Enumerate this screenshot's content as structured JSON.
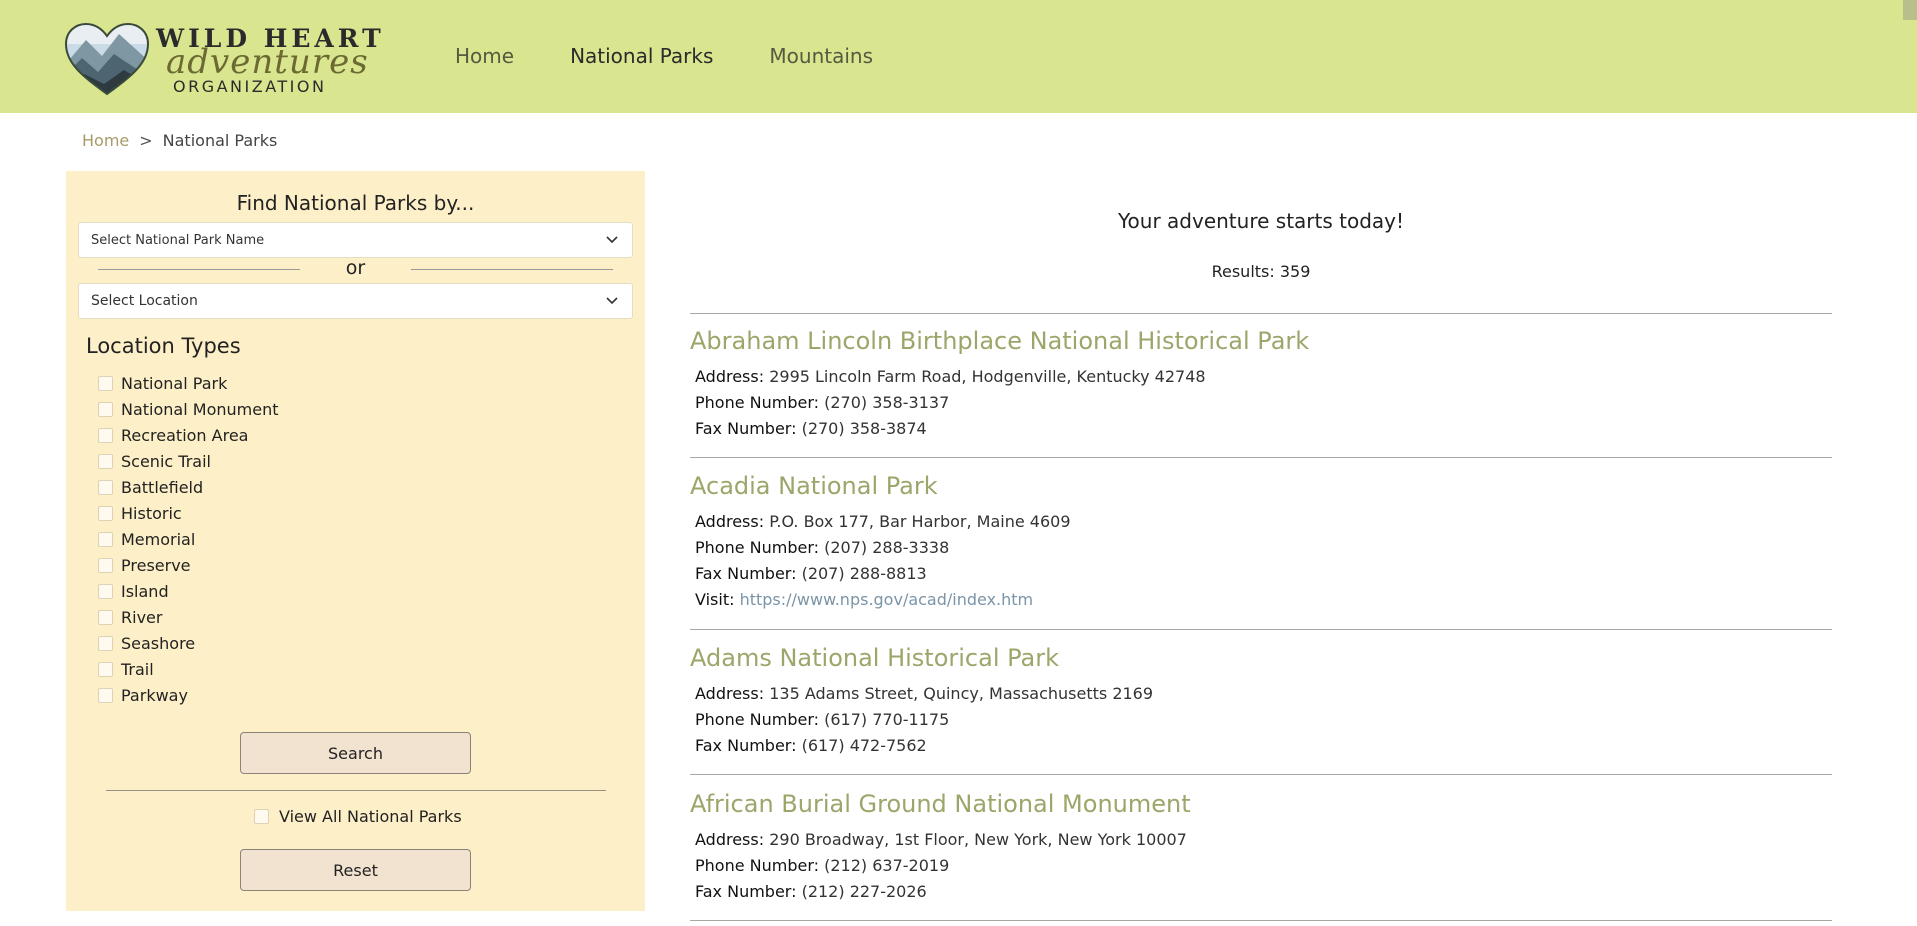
{
  "header": {
    "logo": {
      "line1": "WILD HEART",
      "line2": "adventures",
      "line3": "ORGANIZATION"
    },
    "nav": [
      {
        "label": "Home"
      },
      {
        "label": "National Parks",
        "active": true
      },
      {
        "label": "Mountains"
      }
    ],
    "colors": {
      "header_bg": "#d9e58f",
      "sidebar_bg": "#fdf0c8",
      "accent": "#9ca66a"
    }
  },
  "breadcrumb": {
    "home": "Home",
    "separator": ">",
    "current": "National Parks"
  },
  "sidebar": {
    "title": "Find National Parks by...",
    "park_select": {
      "value": "Select National Park Name",
      "icon": "chevron-down-icon"
    },
    "or_label": "or",
    "location_select": {
      "value": "Select Location",
      "icon": "chevron-down-icon"
    },
    "location_types_title": "Location Types",
    "location_types": [
      {
        "label": "National Park",
        "checked": false
      },
      {
        "label": "National Monument",
        "checked": false
      },
      {
        "label": "Recreation Area",
        "checked": false
      },
      {
        "label": "Scenic Trail",
        "checked": false
      },
      {
        "label": "Battlefield",
        "checked": false
      },
      {
        "label": "Historic",
        "checked": false
      },
      {
        "label": "Memorial",
        "checked": false
      },
      {
        "label": "Preserve",
        "checked": false
      },
      {
        "label": "Island",
        "checked": false
      },
      {
        "label": "River",
        "checked": false
      },
      {
        "label": "Seashore",
        "checked": false
      },
      {
        "label": "Trail",
        "checked": false
      },
      {
        "label": "Parkway",
        "checked": false
      }
    ],
    "search_label": "Search",
    "view_all_label": "View All National Parks",
    "view_all_checked": false,
    "reset_label": "Reset"
  },
  "main": {
    "tagline": "Your adventure starts today!",
    "results_text": "Results: 359",
    "parks": [
      {
        "name": "Abraham Lincoln Birthplace National Historical Park",
        "fields": [
          {
            "key": "Address:",
            "value": "2995 Lincoln Farm Road, Hodgenville, Kentucky 42748"
          },
          {
            "key": "Phone Number:",
            "value": "(270) 358-3137"
          },
          {
            "key": "Fax Number:",
            "value": "(270) 358-3874"
          }
        ]
      },
      {
        "name": "Acadia National Park",
        "fields": [
          {
            "key": "Address:",
            "value": "P.O. Box 177, Bar Harbor, Maine 4609"
          },
          {
            "key": "Phone Number:",
            "value": "(207) 288-3338"
          },
          {
            "key": "Fax Number:",
            "value": "(207) 288-8813"
          },
          {
            "key": "Visit:",
            "value": "https://www.nps.gov/acad/index.htm",
            "link": true
          }
        ]
      },
      {
        "name": "Adams National Historical Park",
        "fields": [
          {
            "key": "Address:",
            "value": "135 Adams Street, Quincy, Massachusetts 2169"
          },
          {
            "key": "Phone Number:",
            "value": "(617) 770-1175"
          },
          {
            "key": "Fax Number:",
            "value": "(617) 472-7562"
          }
        ]
      },
      {
        "name": "African Burial Ground National Monument",
        "fields": [
          {
            "key": "Address:",
            "value": "290 Broadway, 1st Floor, New York, New York 10007"
          },
          {
            "key": "Phone Number:",
            "value": "(212) 637-2019"
          },
          {
            "key": "Fax Number:",
            "value": "(212) 227-2026"
          }
        ]
      }
    ]
  }
}
